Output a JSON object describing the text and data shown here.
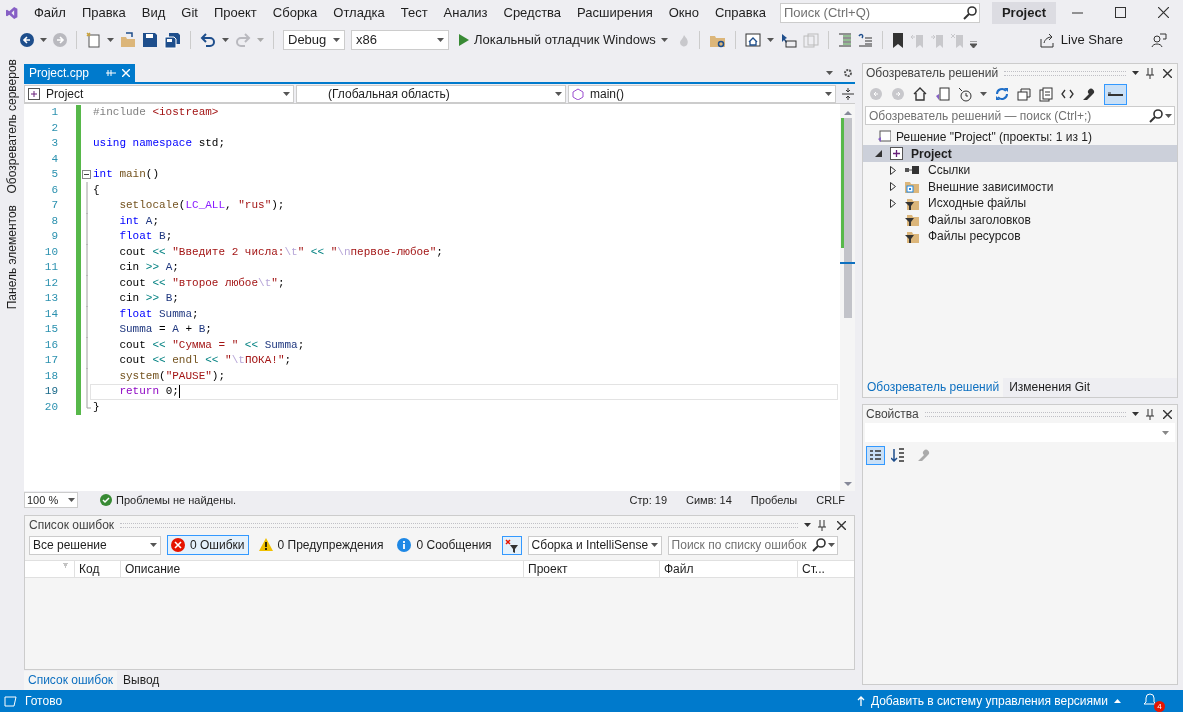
{
  "menu": [
    "Файл",
    "Правка",
    "Вид",
    "Git",
    "Проект",
    "Сборка",
    "Отладка",
    "Тест",
    "Анализ",
    "Средства",
    "Расширения",
    "Окно",
    "Справка"
  ],
  "search": {
    "placeholder": "Поиск (Ctrl+Q)"
  },
  "solution_name": "Project",
  "toolbar": {
    "configuration": "Debug",
    "platform": "x86",
    "run": "Локальный отладчик Windows",
    "live_share": "Live Share"
  },
  "side_tabs": [
    "Обозреватель серверов",
    "Панель элементов"
  ],
  "editor": {
    "tab": {
      "title": "Project.cpp",
      "selected": true
    },
    "nav": [
      "Project",
      "(Глобальная область)",
      "main()"
    ],
    "lines": [
      {
        "n": "1",
        "kind": "plain",
        "current": false,
        "tokens": [
          {
            "kind": "pp",
            "t": "#include "
          },
          {
            "kind": "str",
            "t": "<iostream>"
          }
        ]
      },
      {
        "n": "2",
        "kind": "plain",
        "current": false
      },
      {
        "n": "3",
        "kind": "plain",
        "current": false,
        "tokens": [
          {
            "kind": "kw",
            "t": "using "
          },
          {
            "kind": "kw",
            "t": "namespace "
          },
          {
            "kind": "plain",
            "t": "std;"
          }
        ]
      },
      {
        "n": "4",
        "kind": "plain",
        "current": false
      },
      {
        "n": "5",
        "kind": "fold_start",
        "current": false,
        "tokens": [
          {
            "kind": "kw",
            "t": "int "
          },
          {
            "kind": "fn",
            "t": "main"
          },
          {
            "kind": "plain",
            "t": "()"
          }
        ]
      },
      {
        "n": "6",
        "kind": "fold_body",
        "current": false,
        "tokens": [
          {
            "kind": "plain",
            "t": "{"
          }
        ]
      },
      {
        "n": "7",
        "kind": "fold_body",
        "current": false,
        "tokens": [
          {
            "kind": "fn",
            "t": "    setlocale"
          },
          {
            "kind": "plain",
            "t": "("
          },
          {
            "kind": "macro",
            "t": "LC_ALL"
          },
          {
            "kind": "plain",
            "t": ", "
          },
          {
            "kind": "str",
            "t": "\"rus\""
          },
          {
            "kind": "plain",
            "t": ");"
          }
        ]
      },
      {
        "n": "8",
        "kind": "fold_body",
        "current": false,
        "tokens": [
          {
            "kind": "kw",
            "t": "    int "
          },
          {
            "kind": "var",
            "t": "A"
          },
          {
            "kind": "plain",
            "t": ";"
          }
        ]
      },
      {
        "n": "9",
        "kind": "fold_body",
        "current": false,
        "tokens": [
          {
            "kind": "kw",
            "t": "    float "
          },
          {
            "kind": "var",
            "t": "B"
          },
          {
            "kind": "plain",
            "t": ";"
          }
        ]
      },
      {
        "n": "10",
        "kind": "fold_body",
        "current": false,
        "tokens": [
          {
            "kind": "plain",
            "t": "    cout "
          },
          {
            "kind": "op",
            "t": "<< "
          },
          {
            "kind": "str",
            "t": "\"Введите 2 числа:"
          },
          {
            "kind": "esc",
            "t": "\\t"
          },
          {
            "kind": "str",
            "t": "\" "
          },
          {
            "kind": "op",
            "t": "<< "
          },
          {
            "kind": "str",
            "t": "\""
          },
          {
            "kind": "esc",
            "t": "\\n"
          },
          {
            "kind": "str",
            "t": "первое-любое\""
          },
          {
            "kind": "plain",
            "t": ";"
          }
        ]
      },
      {
        "n": "11",
        "kind": "fold_body",
        "current": false,
        "tokens": [
          {
            "kind": "plain",
            "t": "    cin "
          },
          {
            "kind": "op",
            "t": ">> "
          },
          {
            "kind": "var",
            "t": "A"
          },
          {
            "kind": "plain",
            "t": ";"
          }
        ]
      },
      {
        "n": "12",
        "kind": "fold_body",
        "current": false,
        "tokens": [
          {
            "kind": "plain",
            "t": "    cout "
          },
          {
            "kind": "op",
            "t": "<< "
          },
          {
            "kind": "str",
            "t": "\"второе любое"
          },
          {
            "kind": "esc",
            "t": "\\t"
          },
          {
            "kind": "str",
            "t": "\""
          },
          {
            "kind": "plain",
            "t": ";"
          }
        ]
      },
      {
        "n": "13",
        "kind": "fold_body",
        "current": false,
        "tokens": [
          {
            "kind": "plain",
            "t": "    cin "
          },
          {
            "kind": "op",
            "t": ">> "
          },
          {
            "kind": "var",
            "t": "B"
          },
          {
            "kind": "plain",
            "t": ";"
          }
        ]
      },
      {
        "n": "14",
        "kind": "fold_body",
        "current": false,
        "tokens": [
          {
            "kind": "kw",
            "t": "    float "
          },
          {
            "kind": "var",
            "t": "Summa"
          },
          {
            "kind": "plain",
            "t": ";"
          }
        ]
      },
      {
        "n": "15",
        "kind": "fold_body",
        "current": false,
        "tokens": [
          {
            "kind": "var",
            "t": "    Summa "
          },
          {
            "kind": "plain",
            "t": "= "
          },
          {
            "kind": "var",
            "t": "A "
          },
          {
            "kind": "plain",
            "t": "+ "
          },
          {
            "kind": "var",
            "t": "B"
          },
          {
            "kind": "plain",
            "t": ";"
          }
        ]
      },
      {
        "n": "16",
        "kind": "fold_body",
        "current": false,
        "tokens": [
          {
            "kind": "plain",
            "t": "    cout "
          },
          {
            "kind": "op",
            "t": "<< "
          },
          {
            "kind": "str",
            "t": "\"Сумма = \" "
          },
          {
            "kind": "op",
            "t": "<< "
          },
          {
            "kind": "var",
            "t": "Summa"
          },
          {
            "kind": "plain",
            "t": ";"
          }
        ]
      },
      {
        "n": "17",
        "kind": "fold_body",
        "current": false,
        "tokens": [
          {
            "kind": "plain",
            "t": "    cout "
          },
          {
            "kind": "op",
            "t": "<< "
          },
          {
            "kind": "fn",
            "t": "endl "
          },
          {
            "kind": "op",
            "t": "<< "
          },
          {
            "kind": "str",
            "t": "\""
          },
          {
            "kind": "esc",
            "t": "\\t"
          },
          {
            "kind": "str",
            "t": "ПОКА!\""
          },
          {
            "kind": "plain",
            "t": ";"
          }
        ]
      },
      {
        "n": "18",
        "kind": "fold_body",
        "current": false,
        "tokens": [
          {
            "kind": "fn",
            "t": "    system"
          },
          {
            "kind": "plain",
            "t": "("
          },
          {
            "kind": "str",
            "t": "\"PAUSE\""
          },
          {
            "kind": "plain",
            "t": ");"
          }
        ]
      },
      {
        "n": "19",
        "kind": "fold_body",
        "current": true,
        "tokens": [
          {
            "kind": "ret",
            "t": "    return "
          },
          {
            "kind": "plain",
            "t": "0;"
          }
        ]
      },
      {
        "n": "20",
        "kind": "fold_end",
        "current": false,
        "tokens": [
          {
            "kind": "plain",
            "t": "}"
          }
        ]
      }
    ],
    "zoom": "100 %",
    "health": "Проблемы не найдены.",
    "position": [
      "Стр: 19",
      "Симв: 14",
      "Пробелы",
      "CRLF"
    ]
  },
  "error_list": {
    "title": "Список ошибок",
    "scope": "Все решение",
    "filters": [
      {
        "kind": "error",
        "label": "0 Ошибки",
        "selected": true
      },
      {
        "kind": "warning",
        "label": "0 Предупреждения",
        "selected": false
      },
      {
        "kind": "info",
        "label": "0 Сообщения",
        "selected": false
      }
    ],
    "source": "Сборка и IntelliSense",
    "search_placeholder": "Поиск по списку ошибок",
    "columns": [
      "Код",
      "Описание",
      "Проект",
      "Файл",
      "Ст..."
    ]
  },
  "bottom_tabs": [
    {
      "label": "Список ошибок",
      "selected": true
    },
    {
      "label": "Вывод",
      "selected": false
    }
  ],
  "solution_explorer": {
    "title": "Обозреватель решений",
    "search_placeholder": "Обозреватель решений — поиск (Ctrl+;)",
    "solution": {
      "label": "Решение \"Project\" (проекты: 1 из 1)",
      "project": {
        "label": "Project",
        "expanded": true,
        "selected": true,
        "children": [
          {
            "label": "Ссылки",
            "kind": "references",
            "expandable": true
          },
          {
            "label": "Внешние зависимости",
            "kind": "external",
            "expandable": true
          },
          {
            "label": "Исходные файлы",
            "kind": "filter",
            "expandable": true
          },
          {
            "label": "Файлы заголовков",
            "kind": "filter",
            "expandable": false
          },
          {
            "label": "Файлы ресурсов",
            "kind": "filter",
            "expandable": false
          }
        ]
      }
    },
    "tabs": [
      {
        "label": "Обозреватель решений",
        "selected": true
      },
      {
        "label": "Изменения Git",
        "selected": false
      }
    ]
  },
  "properties": {
    "title": "Свойства"
  },
  "status_bar": {
    "text": "Готово",
    "source_control": "Добавить в систему управления версиями",
    "notifications": "4"
  }
}
